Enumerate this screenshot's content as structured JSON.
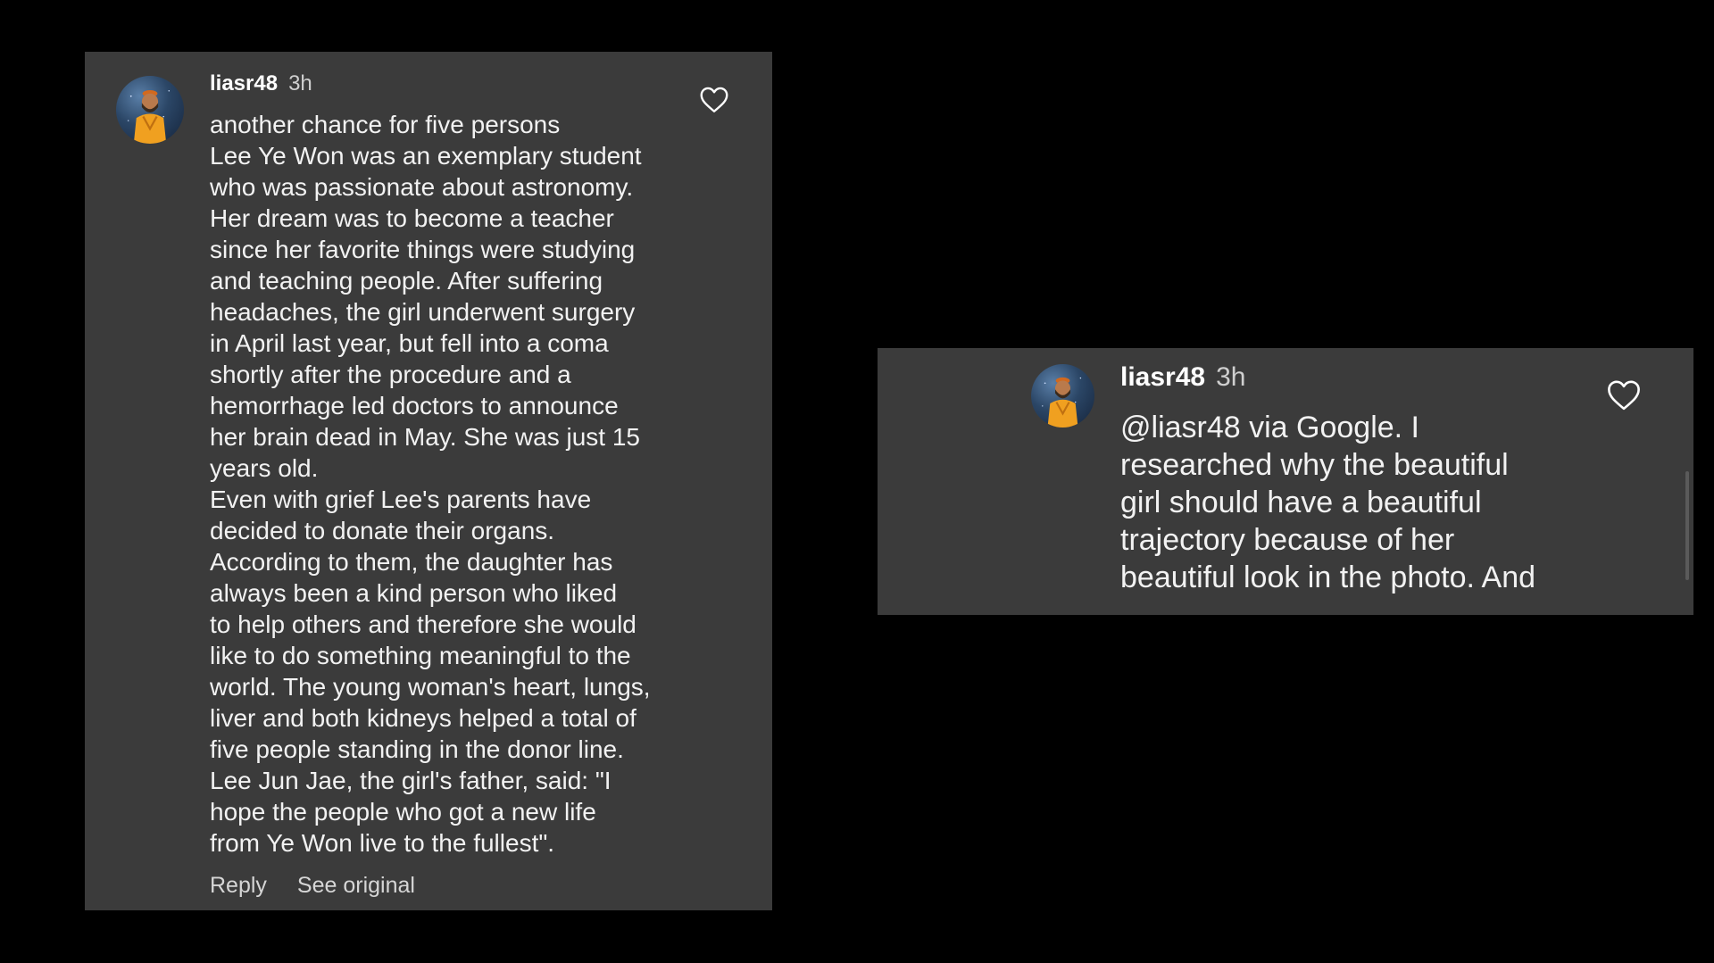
{
  "comments": [
    {
      "username": "liasr48",
      "time": "3h",
      "text": "another chance for five persons\nLee Ye Won was an exemplary student\nwho was passionate about astronomy.\nHer dream was to become a teacher\nsince her favorite things were studying\nand teaching people. After suffering\nheadaches, the girl underwent surgery\nin April last year, but fell into a coma\nshortly after the procedure and a\nhemorrhage led doctors to announce\nher brain dead in May. She was just 15\nyears old.\nEven with grief Lee's parents have\ndecided to donate their organs.\nAccording to them, the daughter has\nalways been a kind person who liked\nto help others and therefore she would\nlike to do something meaningful to the\nworld. The young woman's heart, lungs,\nliver and both kidneys helped a total of\nfive people standing in the donor line.\nLee Jun Jae, the girl's father, said: \"I\nhope the people who got a new life\nfrom Ye Won live to the fullest\".",
      "reply_label": "Reply",
      "see_original_label": "See original",
      "like_icon": "heart-outline-icon"
    },
    {
      "username": "liasr48",
      "time": "3h",
      "text": "@liasr48 via Google. I\nresearched why the beautiful\ngirl should have a beautiful\ntrajectory because of her\nbeautiful look in the photo. And",
      "like_icon": "heart-outline-icon"
    }
  ],
  "colors": {
    "background": "#000000",
    "panel": "#3b3b3b",
    "text": "#f2f2f2",
    "secondary_text": "#cfcfcf"
  }
}
